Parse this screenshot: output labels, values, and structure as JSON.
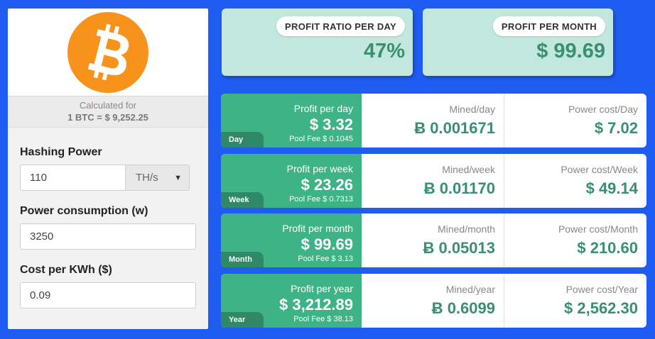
{
  "calc": {
    "label": "Calculated for",
    "price": "1 BTC = $ 9,252.25"
  },
  "form": {
    "hashing_label": "Hashing Power",
    "hashing_value": "110",
    "hashing_unit": "TH/s",
    "power_label": "Power consumption (w)",
    "power_value": "3250",
    "cost_label": "Cost per KWh ($)",
    "cost_value": "0.09"
  },
  "summary": {
    "ratio_label": "PROFIT RATIO PER DAY",
    "ratio_value": "47%",
    "month_label": "PROFIT PER MONTH",
    "month_value": "$ 99.69"
  },
  "rows": [
    {
      "period": "Day",
      "profit_label": "Profit per day",
      "profit_value": "$ 3.32",
      "fee": "Pool Fee $ 0.1045",
      "mined_label": "Mined/day",
      "mined_value": "Ƀ 0.001671",
      "power_label": "Power cost/Day",
      "power_value": "$ 7.02"
    },
    {
      "period": "Week",
      "profit_label": "Profit per week",
      "profit_value": "$ 23.26",
      "fee": "Pool Fee $ 0.7313",
      "mined_label": "Mined/week",
      "mined_value": "Ƀ 0.01170",
      "power_label": "Power cost/Week",
      "power_value": "$ 49.14"
    },
    {
      "period": "Month",
      "profit_label": "Profit per month",
      "profit_value": "$ 99.69",
      "fee": "Pool Fee $ 3.13",
      "mined_label": "Mined/month",
      "mined_value": "Ƀ 0.05013",
      "power_label": "Power cost/Month",
      "power_value": "$ 210.60"
    },
    {
      "period": "Year",
      "profit_label": "Profit per year",
      "profit_value": "$ 3,212.89",
      "fee": "Pool Fee $ 38.13",
      "mined_label": "Mined/year",
      "mined_value": "Ƀ 0.6099",
      "power_label": "Power cost/Year",
      "power_value": "$ 2,562.30"
    }
  ],
  "colors": {
    "background": "#1f5cf2",
    "profit_green": "#3db386",
    "tab_green": "#2f8866",
    "value_green": "#3a8f72",
    "summary_bg": "#c2e7dc",
    "bitcoin_orange": "#f7931a"
  },
  "icons": {
    "logo": "bitcoin-logo-icon",
    "unit_caret": "caret-down-icon"
  }
}
